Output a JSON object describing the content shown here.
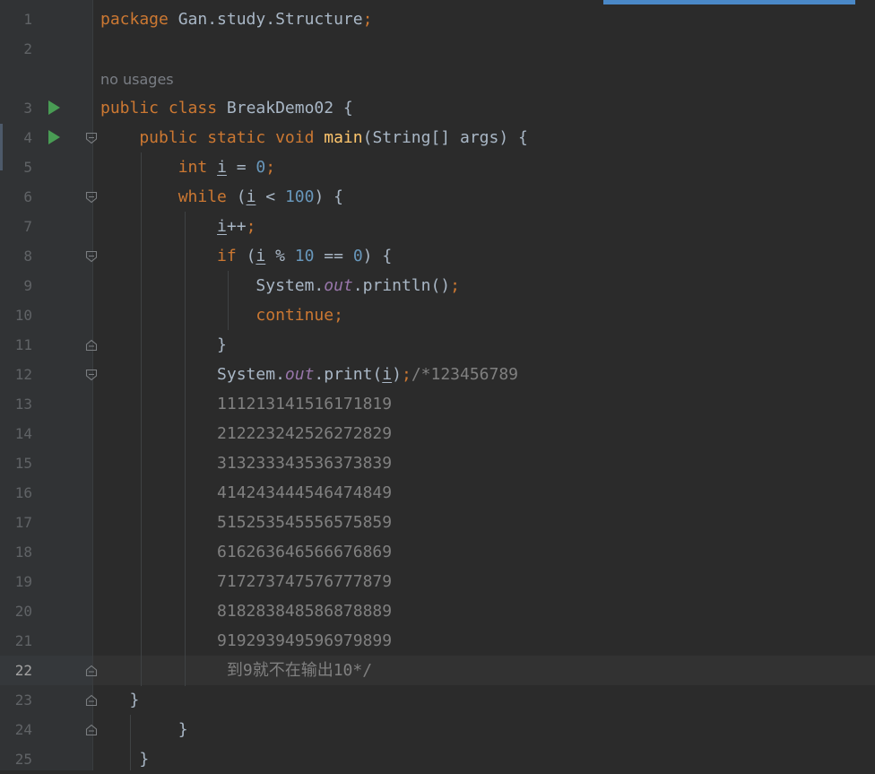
{
  "editor": {
    "usage_hint": "no usages",
    "lines": [
      {
        "num": "1",
        "parts": [
          {
            "t": "package ",
            "c": "kw"
          },
          {
            "t": "Gan.study.Structure",
            "c": "plain"
          },
          {
            "t": ";",
            "c": "kw"
          }
        ]
      },
      {
        "num": "2",
        "parts": []
      },
      {
        "num": "3",
        "run": true,
        "parts": [
          {
            "t": "public class ",
            "c": "kw"
          },
          {
            "t": "BreakDemo02 {",
            "c": "plain"
          }
        ]
      },
      {
        "num": "4",
        "run": true,
        "fold": "open",
        "parts": [
          {
            "t": "    public static void ",
            "c": "kw"
          },
          {
            "t": "main",
            "c": "fn"
          },
          {
            "t": "(String[] args) {",
            "c": "plain"
          }
        ]
      },
      {
        "num": "5",
        "parts": [
          {
            "t": "        ",
            "c": "plain"
          },
          {
            "t": "int ",
            "c": "kw"
          },
          {
            "t": "i",
            "c": "uvar"
          },
          {
            "t": " = ",
            "c": "plain"
          },
          {
            "t": "0",
            "c": "num"
          },
          {
            "t": ";",
            "c": "kw"
          }
        ]
      },
      {
        "num": "6",
        "fold": "open",
        "parts": [
          {
            "t": "        ",
            "c": "plain"
          },
          {
            "t": "while ",
            "c": "kw"
          },
          {
            "t": "(",
            "c": "plain"
          },
          {
            "t": "i",
            "c": "uvar"
          },
          {
            "t": " < ",
            "c": "plain"
          },
          {
            "t": "100",
            "c": "num"
          },
          {
            "t": ") {",
            "c": "plain"
          }
        ]
      },
      {
        "num": "7",
        "parts": [
          {
            "t": "            ",
            "c": "plain"
          },
          {
            "t": "i",
            "c": "uvar"
          },
          {
            "t": "++",
            "c": "plain"
          },
          {
            "t": ";",
            "c": "kw"
          }
        ]
      },
      {
        "num": "8",
        "fold": "open",
        "parts": [
          {
            "t": "            ",
            "c": "plain"
          },
          {
            "t": "if ",
            "c": "kw"
          },
          {
            "t": "(",
            "c": "plain"
          },
          {
            "t": "i",
            "c": "uvar"
          },
          {
            "t": " % ",
            "c": "plain"
          },
          {
            "t": "10",
            "c": "num"
          },
          {
            "t": " == ",
            "c": "plain"
          },
          {
            "t": "0",
            "c": "num"
          },
          {
            "t": ") {",
            "c": "plain"
          }
        ]
      },
      {
        "num": "9",
        "parts": [
          {
            "t": "                System.",
            "c": "plain"
          },
          {
            "t": "out",
            "c": "fld"
          },
          {
            "t": ".println()",
            "c": "plain"
          },
          {
            "t": ";",
            "c": "kw"
          }
        ]
      },
      {
        "num": "10",
        "parts": [
          {
            "t": "                ",
            "c": "plain"
          },
          {
            "t": "continue;",
            "c": "kw"
          }
        ]
      },
      {
        "num": "11",
        "fold": "close",
        "parts": [
          {
            "t": "            }",
            "c": "plain"
          }
        ]
      },
      {
        "num": "12",
        "fold": "open",
        "parts": [
          {
            "t": "            System.",
            "c": "plain"
          },
          {
            "t": "out",
            "c": "fld"
          },
          {
            "t": ".print(",
            "c": "plain"
          },
          {
            "t": "i",
            "c": "uvar"
          },
          {
            "t": ")",
            "c": "plain"
          },
          {
            "t": ";",
            "c": "kw"
          },
          {
            "t": "/*123456789",
            "c": "cm"
          }
        ]
      },
      {
        "num": "13",
        "parts": [
          {
            "t": "            11121314151617181 9",
            "c": "cm"
          }
        ]
      },
      {
        "num": "14",
        "parts": [
          {
            "t": "            21222324252627282 9",
            "c": "cm"
          }
        ]
      },
      {
        "num": "15",
        "parts": [
          {
            "t": "            31323334353637383 9",
            "c": "cm"
          }
        ]
      },
      {
        "num": "16",
        "parts": [
          {
            "t": "            41424344454647484 9",
            "c": "cm"
          }
        ]
      },
      {
        "num": "17",
        "parts": [
          {
            "t": "            51525354555657585 9",
            "c": "cm"
          }
        ]
      },
      {
        "num": "18",
        "parts": [
          {
            "t": "            61626364656667686 9",
            "c": "cm"
          }
        ]
      },
      {
        "num": "19",
        "parts": [
          {
            "t": "            71727374757677787 9",
            "c": "cm"
          }
        ]
      },
      {
        "num": "20",
        "parts": [
          {
            "t": "            81828384858687888 9",
            "c": "cm"
          }
        ]
      },
      {
        "num": "21",
        "parts": [
          {
            "t": "            91929394959697989 9",
            "c": "cm"
          }
        ]
      },
      {
        "num": "22",
        "active": true,
        "fold": "close",
        "parts": [
          {
            "t": "             到9就不在输出10*/",
            "c": "cm"
          }
        ]
      },
      {
        "num": "23",
        "fold": "close",
        "parts": [
          {
            "t": "   }",
            "c": "plain"
          }
        ]
      },
      {
        "num": "24",
        "fold": "close",
        "parts": [
          {
            "t": "        }",
            "c": "plain"
          }
        ]
      },
      {
        "num": "25",
        "parts": [
          {
            "t": "    }",
            "c": "plain"
          }
        ]
      }
    ]
  },
  "colors": {
    "background": "#2b2b2b",
    "keyword": "#cc7832",
    "number": "#6897bb",
    "method": "#ffc66d",
    "field": "#9876aa",
    "comment": "#808080"
  }
}
